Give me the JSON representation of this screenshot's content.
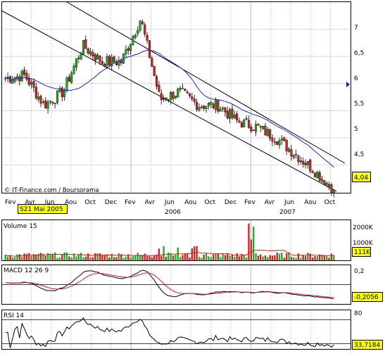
{
  "watermark": "© IT-Finance.com / Boursorama",
  "cursor_label": "S21 Mai 2005",
  "main": {
    "y_ticks": [
      "7",
      "6,5",
      "6",
      "5,5",
      "5",
      "4,5"
    ],
    "last_price_label": "4,04",
    "x_month_labels": [
      "Fev",
      "Avr",
      "Jun",
      "Aou",
      "Oct",
      "Dec",
      "Fev",
      "Avr",
      "Jun",
      "Aou",
      "Oct",
      "Dec",
      "Fev",
      "Avr",
      "Jun",
      "Aou",
      "Oct"
    ],
    "year_labels": [
      "2006",
      "2007"
    ]
  },
  "volume": {
    "title": "Volume 15",
    "y_ticks": [
      "2000K",
      "1000K"
    ],
    "last_label": "111K"
  },
  "macd": {
    "title": "MACD 12 26 9",
    "y_ticks": [
      "0,2"
    ],
    "last_label": "-0,2056"
  },
  "rsi": {
    "title": "RSI 14",
    "y_ticks": [
      "80"
    ],
    "last_label": "33,7184"
  },
  "colors": {
    "up": "#22aa22",
    "down": "#cc2222",
    "ma": "#2222cc",
    "signal": "#cc2222",
    "label_bg": "#ffff00"
  },
  "chart_data": {
    "type": "line",
    "x": [
      "2005-02",
      "2005-04",
      "2005-06",
      "2005-08",
      "2005-10",
      "2005-12",
      "2006-02",
      "2006-04",
      "2006-06",
      "2006-08",
      "2006-10",
      "2006-12",
      "2007-02",
      "2007-04",
      "2007-06",
      "2007-08",
      "2007-10",
      "2007-11"
    ],
    "series": [
      {
        "values": [
          6.1,
          6.15,
          5.6,
          5.85,
          6.7,
          6.4,
          6.4,
          7.2,
          5.7,
          5.85,
          5.6,
          5.6,
          5.3,
          5.2,
          5.0,
          4.7,
          4.4,
          4.04
        ]
      }
    ],
    "ylim": [
      4.0,
      7.5
    ],
    "volume_ylim": [
      0,
      2500000
    ],
    "macd_ylim": [
      -0.3,
      0.25
    ],
    "rsi_ylim": [
      20,
      90
    ]
  }
}
